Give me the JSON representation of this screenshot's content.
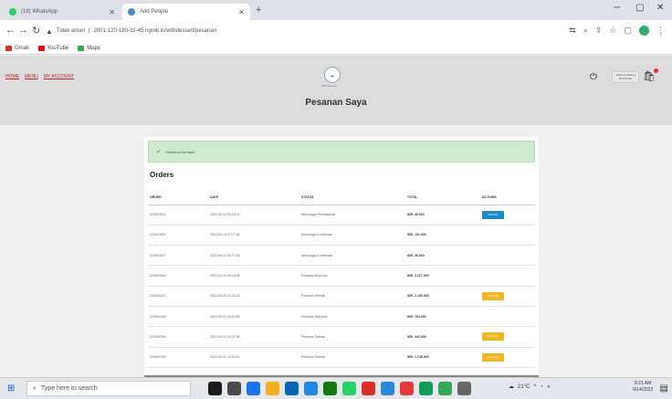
{
  "browser": {
    "tabs": [
      {
        "label": "(19) WhatsApp",
        "icon_color": "#25d366"
      },
      {
        "label": "Add People",
        "icon_color": "#4a8bd2"
      }
    ],
    "address": {
      "security_label": "Tidak aman",
      "url": "2001-120-180-32-45.ngrok.io/withdessert/pesanan"
    },
    "bookmarks": [
      {
        "label": "Gmail",
        "icon_color": "#d93025"
      },
      {
        "label": "YouTube",
        "icon_color": "#ff0000"
      },
      {
        "label": "Maps",
        "icon_color": "#34a853"
      }
    ]
  },
  "site": {
    "nav": [
      "HOME",
      "MENU",
      "MY ACCOUNT"
    ],
    "logo_text": "With Dessert",
    "page_title": "Pesanan Saya",
    "user_box": {
      "line1": "Selamat datang",
      "line2": "ROS DOE"
    }
  },
  "content": {
    "alert": "Checkout berhasil",
    "orders_title": "Orders",
    "columns": [
      "ORDER",
      "DATE",
      "STATUS",
      "TOTAL",
      "ACTIONS"
    ],
    "rows": [
      {
        "order": "220914001",
        "date": "2022-09-14 09:18:11",
        "status": "Menunggu Pembayaran",
        "total": "IDR. 25.000",
        "action": "BAYAR",
        "action_type": "bayar"
      },
      {
        "order": "220913049",
        "date": "2022-09-13 07:17:48",
        "status": "Menunggu Konfirmasi",
        "total": "IDR. 101.000",
        "action": "",
        "action_type": ""
      },
      {
        "order": "220913047",
        "date": "2022-09-13 06:17:39",
        "status": "Menunggu Konfirmasi",
        "total": "IDR. 35.000",
        "action": "",
        "action_type": ""
      },
      {
        "order": "220913046",
        "date": "2022-09-13 06:16:05",
        "status": "Pesanan Diproses",
        "total": "IDR. 2.377.000",
        "action": "",
        "action_type": ""
      },
      {
        "order": "220902010",
        "date": "2022-09-02 12:21:01",
        "status": "Pesanan Selesai",
        "total": "IDR. 1.153.000",
        "action": "REVIEW",
        "action_type": "review"
      },
      {
        "order": "220901008",
        "date": "2022-09-01 03:24:59",
        "status": "Pesanan Diproses",
        "total": "IDR. 793.000",
        "action": "",
        "action_type": ""
      },
      {
        "order": "220901006",
        "date": "2022-09-01 03:21:34",
        "status": "Pesanan Selesai",
        "total": "IDR. 342.000",
        "action": "REVIEW",
        "action_type": "review"
      },
      {
        "order": "220901005",
        "date": "2022-09-01 10:42:31",
        "status": "Pesanan Selesai",
        "total": "IDR. 1.748.000",
        "action": "REVIEW",
        "action_type": "review"
      }
    ]
  },
  "taskbar": {
    "search_placeholder": "Type here to search",
    "weather": "21°C",
    "time": "8:21 AM",
    "date": "9/14/2022",
    "apps": [
      "#1a1a1a",
      "#4a4a4a",
      "#1a73e8",
      "#f2b01e",
      "#0067b8",
      "#1e88e5",
      "#107c10",
      "#25d366",
      "#d93025",
      "#2b88d8",
      "#e53935",
      "#0f9d58",
      "#34a853",
      "#666666"
    ]
  }
}
